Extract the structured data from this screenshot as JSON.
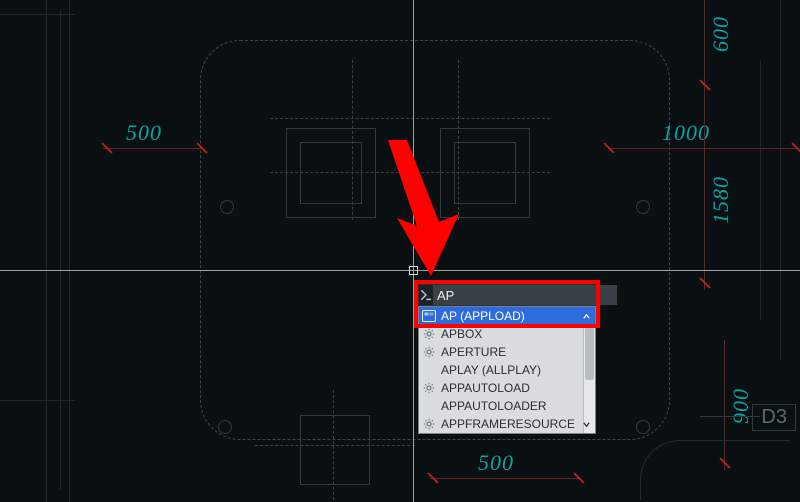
{
  "command": {
    "input_value": "AP",
    "placeholder": ""
  },
  "autocomplete": {
    "items": [
      {
        "label": "AP (APPLOAD)",
        "icon": "swatch-icon",
        "selected": true,
        "expandable": true
      },
      {
        "label": "APBOX",
        "icon": "gear-icon",
        "selected": false,
        "expandable": false
      },
      {
        "label": "APERTURE",
        "icon": "gear-icon",
        "selected": false,
        "expandable": false
      },
      {
        "label": "APLAY (ALLPLAY)",
        "icon": "",
        "selected": false,
        "expandable": false
      },
      {
        "label": "APPAUTOLOAD",
        "icon": "gear-icon",
        "selected": false,
        "expandable": false
      },
      {
        "label": "APPAUTOLOADER",
        "icon": "",
        "selected": false,
        "expandable": false
      },
      {
        "label": "APPFRAMERESOURCES",
        "icon": "gear-icon",
        "selected": false,
        "expandable": true
      }
    ]
  },
  "dimensions": {
    "d500a": "500",
    "d1000": "1000",
    "d600": "600",
    "d1580": "1580",
    "d500b": "500",
    "d900": "900"
  },
  "grid": {
    "label_d3": "D3"
  },
  "annotation": {
    "arrow_target": "command-input"
  }
}
